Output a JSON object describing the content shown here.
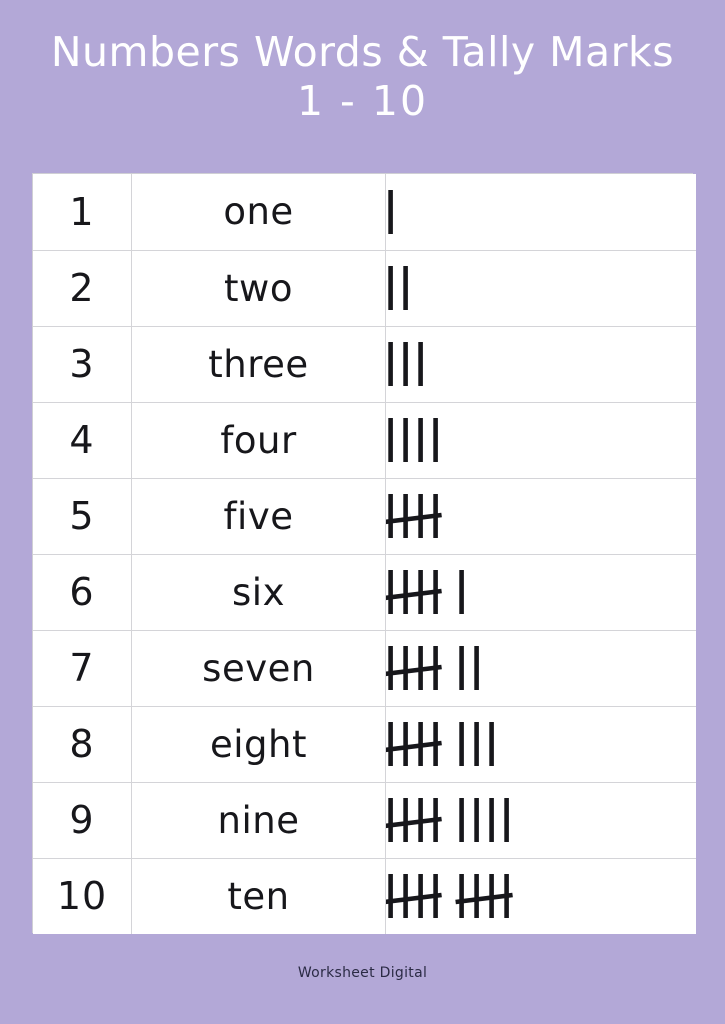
{
  "page": {
    "background_color": "#b3a8d7",
    "title_color": "#ffffff",
    "ink_color": "#17171b",
    "border_color": "#d4d4d8",
    "cell_background": "#ffffff"
  },
  "header": {
    "title": "Numbers Words & Tally Marks",
    "subtitle": "1 - 10"
  },
  "footer": {
    "credit": "Worksheet Digital"
  },
  "table": {
    "columns": [
      "numeral",
      "word",
      "tally"
    ],
    "rows": [
      {
        "numeral": "1",
        "word": "one",
        "tally_count": 1,
        "tally_text": "I"
      },
      {
        "numeral": "2",
        "word": "two",
        "tally_count": 2,
        "tally_text": "II"
      },
      {
        "numeral": "3",
        "word": "three",
        "tally_count": 3,
        "tally_text": "III"
      },
      {
        "numeral": "4",
        "word": "four",
        "tally_count": 4,
        "tally_text": "IIII"
      },
      {
        "numeral": "5",
        "word": "five",
        "tally_count": 5,
        "tally_text": "HHH"
      },
      {
        "numeral": "6",
        "word": "six",
        "tally_count": 6,
        "tally_text": "HHH I"
      },
      {
        "numeral": "7",
        "word": "seven",
        "tally_count": 7,
        "tally_text": "HHH II"
      },
      {
        "numeral": "8",
        "word": "eight",
        "tally_count": 8,
        "tally_text": "HHH III"
      },
      {
        "numeral": "9",
        "word": "nine",
        "tally_count": 9,
        "tally_text": "HHH IIII"
      },
      {
        "numeral": "10",
        "word": "ten",
        "tally_count": 10,
        "tally_text": "HHH HHH"
      }
    ]
  }
}
